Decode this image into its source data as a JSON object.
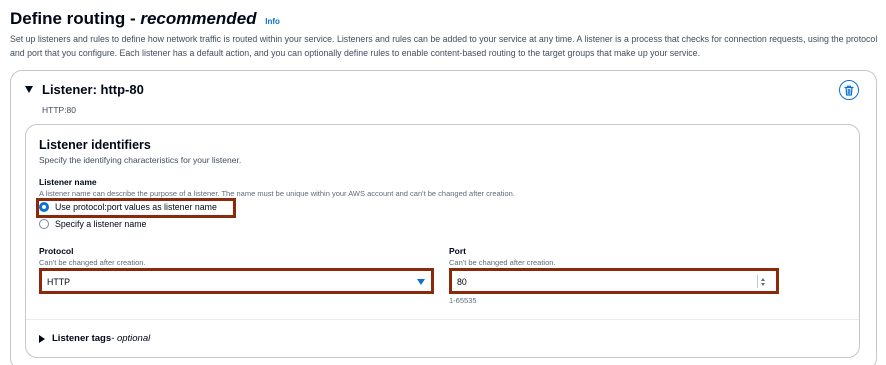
{
  "header": {
    "title_main": "Define routing - ",
    "title_emphasis": "recommended",
    "info_link": "Info",
    "description": "Set up listeners and rules to define how network traffic is routed within your service. Listeners and rules can be added to your service at any time. A listener is a process that checks for connection requests, using the protocol and port that you configure. Each listener has a default action, and you can optionally define rules to enable content-based routing to the target groups that make up your service."
  },
  "listener": {
    "title": "Listener: http-80",
    "subtitle": "HTTP:80",
    "delete_icon": "trash-icon"
  },
  "identifiers": {
    "title": "Listener identifiers",
    "description": "Specify the identifying characteristics for your listener.",
    "name_label": "Listener name",
    "name_description": "A listener name can describe the purpose of a listener. The name must be unique within your AWS account and can't be changed after creation.",
    "options": [
      {
        "label": "Use protocol:port values as listener name",
        "selected": true
      },
      {
        "label": "Specify a listener name",
        "selected": false
      }
    ],
    "protocol": {
      "label": "Protocol",
      "description": "Can't be changed after creation.",
      "value": "HTTP"
    },
    "port": {
      "label": "Port",
      "description": "Can't be changed after creation.",
      "value": "80",
      "constraint": "1-65535"
    }
  },
  "tags": {
    "label": "Listener tags",
    "optional": " - optional"
  },
  "colors": {
    "accent": "#0972d3",
    "highlight": "#8a2a0a",
    "text": "#000716",
    "muted": "#5f6b7a"
  }
}
